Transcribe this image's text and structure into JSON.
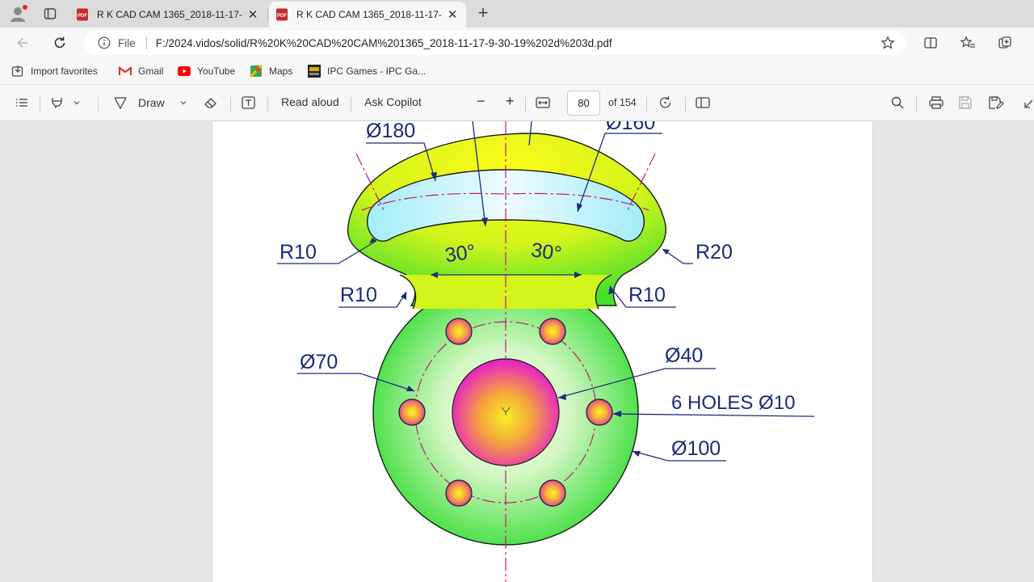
{
  "browser": {
    "tabs": [
      {
        "title": "R K CAD CAM 1365_2018-11-17-",
        "active": false
      },
      {
        "title": "R K CAD CAM 1365_2018-11-17-",
        "active": true
      }
    ],
    "address": {
      "scheme_label": "File",
      "url": "F:/2024.vidos/solid/R%20K%20CAD%20CAM%201365_2018-11-17-9-30-19%202d%203d.pdf"
    },
    "favorites": [
      {
        "label": "Import favorites",
        "icon": "import-icon"
      },
      {
        "label": "Gmail",
        "icon": "gmail-icon"
      },
      {
        "label": "YouTube",
        "icon": "youtube-icon"
      },
      {
        "label": "Maps",
        "icon": "maps-icon"
      },
      {
        "label": "IPC Games - IPC Ga...",
        "icon": "ipc-icon"
      }
    ]
  },
  "pdf_toolbar": {
    "draw_label": "Draw",
    "read_aloud_label": "Read aloud",
    "ask_copilot_label": "Ask Copilot",
    "zoom_out": "−",
    "zoom_in": "+",
    "current_page": "80",
    "page_total": "of 154"
  },
  "drawing": {
    "labels": {
      "d180": "Ø180",
      "d160": "Ø160",
      "r10_left_slot": "R10",
      "r20": "R20",
      "r10_neck_left": "R10",
      "r10_neck_right": "R10",
      "angle_left": "30°",
      "angle_right": "30°",
      "d70": "Ø70",
      "d40": "Ø40",
      "holes": "6 HOLES Ø10",
      "d100": "Ø100"
    },
    "colors": {
      "outline": "#1a1a1a",
      "dim": "#1c2a7a",
      "center_line": "#c2187a",
      "body_green": "#3fe03f",
      "arm_yellow": "#f4f50a",
      "slot_cyan": "#a6f0fb",
      "hub_magenta": "#e020c8"
    }
  }
}
